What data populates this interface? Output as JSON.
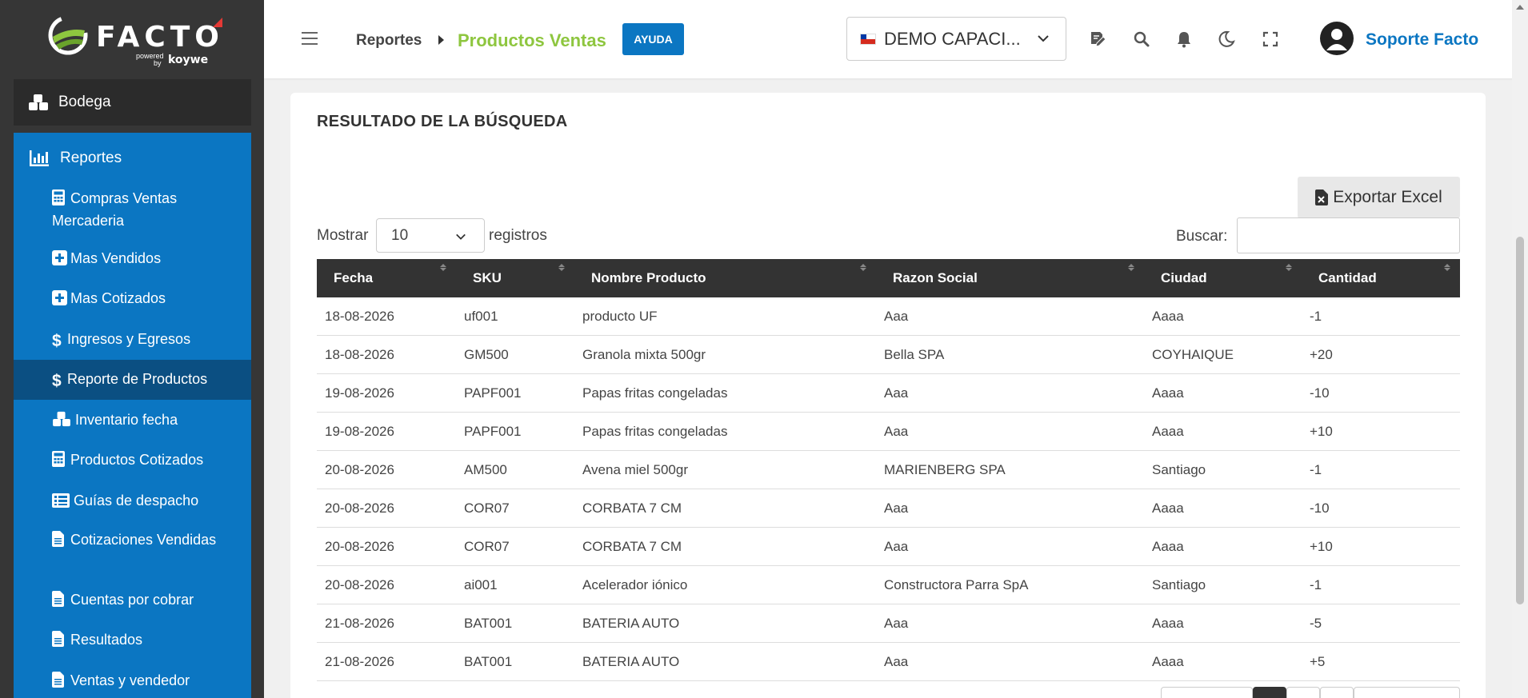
{
  "logo": {
    "word": "FACTO",
    "powered": "powered",
    "by": "by",
    "brand": "koywe"
  },
  "sidebar": {
    "bodega_label": "Bodega",
    "reportes_label": "Reportes",
    "items": [
      {
        "label": "Compras Ventas Mercaderia",
        "icon": "calculator-icon"
      },
      {
        "label": "Mas Vendidos",
        "icon": "plus-square-icon"
      },
      {
        "label": "Mas Cotizados",
        "icon": "plus-square-icon"
      },
      {
        "label": "Ingresos y Egresos",
        "icon": "dollar-icon"
      },
      {
        "label": "Reporte de Productos",
        "icon": "dollar-icon",
        "active": true
      },
      {
        "label": "Inventario fecha",
        "icon": "cubes-icon"
      },
      {
        "label": "Productos Cotizados",
        "icon": "calculator-icon"
      },
      {
        "label": "Guías de despacho",
        "icon": "list-icon"
      },
      {
        "label": "Cotizaciones Vendidas",
        "icon": "file-icon"
      },
      {
        "label": "Cuentas por cobrar",
        "icon": "file-icon"
      },
      {
        "label": "Resultados",
        "icon": "file-icon"
      },
      {
        "label": "Ventas y vendedor",
        "icon": "file-icon"
      }
    ]
  },
  "header": {
    "breadcrumb_parent": "Reportes",
    "breadcrumb_current": "Productos Ventas",
    "help_label": "AYUDA",
    "company": "DEMO CAPACI...",
    "user_name": "Soporte Facto"
  },
  "main": {
    "title": "RESULTADO DE LA BÚSQUEDA",
    "export_label": "Exportar Excel",
    "show_label": "Mostrar",
    "show_value": "10",
    "records_label": "registros",
    "search_label": "Buscar:",
    "search_value": ""
  },
  "table": {
    "columns": [
      "Fecha",
      "SKU",
      "Nombre Producto",
      "Razon Social",
      "Ciudad",
      "Cantidad"
    ],
    "rows": [
      [
        "18-08-2026",
        "uf001",
        "producto UF",
        "Aaa",
        "Aaaa",
        "-1"
      ],
      [
        "18-08-2026",
        "GM500",
        "Granola mixta 500gr",
        "Bella SPA",
        "COYHAIQUE",
        "+20"
      ],
      [
        "19-08-2026",
        "PAPF001",
        "Papas fritas congeladas",
        "Aaa",
        "Aaaa",
        "-10"
      ],
      [
        "19-08-2026",
        "PAPF001",
        "Papas fritas congeladas",
        "Aaa",
        "Aaaa",
        "+10"
      ],
      [
        "20-08-2026",
        "AM500",
        "Avena miel 500gr",
        "MARIENBERG SPA",
        "Santiago",
        "-1"
      ],
      [
        "20-08-2026",
        "COR07",
        "CORBATA 7 CM",
        "Aaa",
        "Aaaa",
        "-10"
      ],
      [
        "20-08-2026",
        "COR07",
        "CORBATA 7 CM",
        "Aaa",
        "Aaaa",
        "+10"
      ],
      [
        "20-08-2026",
        "ai001",
        "Acelerador iónico",
        "Constructora Parra SpA",
        "Santiago",
        "-1"
      ],
      [
        "21-08-2026",
        "BAT001",
        "BATERIA AUTO",
        "Aaa",
        "Aaaa",
        "-5"
      ],
      [
        "21-08-2026",
        "BAT001",
        "BATERIA AUTO",
        "Aaa",
        "Aaaa",
        "+5"
      ]
    ]
  },
  "colors": {
    "sidebar_bg": "#363636",
    "nav_blue": "#0b76c2",
    "nav_active": "#0b4f82",
    "accent_green": "#8ec63f",
    "table_header": "#333333"
  }
}
